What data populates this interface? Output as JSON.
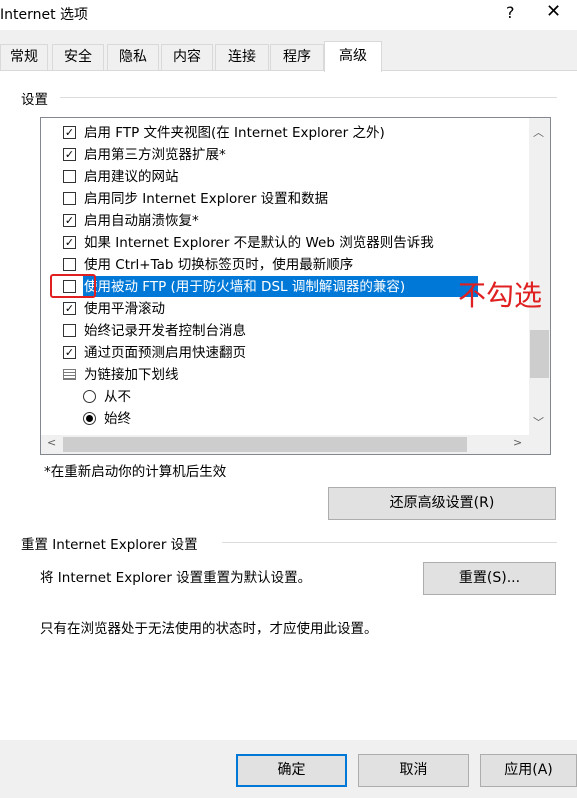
{
  "window": {
    "title": "Internet 选项",
    "help_glyph": "?",
    "close_glyph": "✕"
  },
  "tabs": [
    "常规",
    "安全",
    "隐私",
    "内容",
    "连接",
    "程序",
    "高级"
  ],
  "active_tab": "高级",
  "settings_group": {
    "label": "设置"
  },
  "settings_items": [
    {
      "type": "checkbox",
      "checked": true,
      "label": "启用 FTP 文件夹视图(在 Internet Explorer 之外)"
    },
    {
      "type": "checkbox",
      "checked": true,
      "label": "启用第三方浏览器扩展*"
    },
    {
      "type": "checkbox",
      "checked": false,
      "label": "启用建议的网站"
    },
    {
      "type": "checkbox",
      "checked": false,
      "label": "启用同步 Internet Explorer 设置和数据"
    },
    {
      "type": "checkbox",
      "checked": true,
      "label": "启用自动崩溃恢复*"
    },
    {
      "type": "checkbox",
      "checked": true,
      "label": "如果 Internet Explorer 不是默认的 Web 浏览器则告诉我"
    },
    {
      "type": "checkbox",
      "checked": false,
      "label": "使用 Ctrl+Tab 切换标签页时，使用最新顺序"
    },
    {
      "type": "checkbox",
      "checked": false,
      "label": "使用被动 FTP (用于防火墙和 DSL 调制解调器的兼容)",
      "selected": true
    },
    {
      "type": "checkbox",
      "checked": true,
      "label": "使用平滑滚动"
    },
    {
      "type": "checkbox",
      "checked": false,
      "label": "始终记录开发者控制台消息"
    },
    {
      "type": "checkbox",
      "checked": true,
      "label": "通过页面预测启用快速翻页"
    },
    {
      "type": "group",
      "label": "为链接加下划线"
    },
    {
      "type": "radio",
      "checked": false,
      "label": "从不"
    },
    {
      "type": "radio",
      "checked": true,
      "label": "始终"
    }
  ],
  "restart_note": "*在重新启动你的计算机后生效",
  "restore_button": "还原高级设置(R)",
  "reset_group": {
    "label": "重置 Internet Explorer 设置",
    "description": "将 Internet Explorer 设置重置为默认设置。",
    "reset_button": "重置(S)...",
    "note": "只有在浏览器处于无法使用的状态时，才应使用此设置。"
  },
  "footer": {
    "ok": "确定",
    "cancel": "取消",
    "apply": "应用(A)"
  },
  "annotation": {
    "text": "不勾选",
    "color": "#e02020"
  },
  "colors": {
    "selection": "#0078d7",
    "default_button_border": "#0078d7"
  }
}
